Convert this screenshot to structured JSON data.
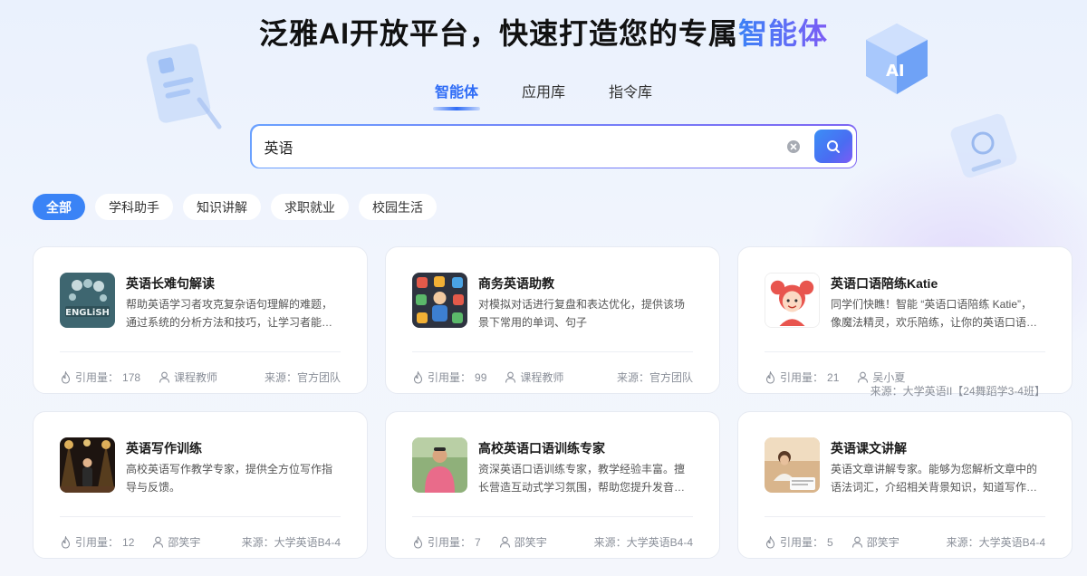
{
  "header": {
    "title_prefix": "泛雅AI开放平台，快速打造您的专属",
    "title_accent": "智能体"
  },
  "tabs": [
    {
      "label": "智能体",
      "active": true
    },
    {
      "label": "应用库",
      "active": false
    },
    {
      "label": "指令库",
      "active": false
    }
  ],
  "search": {
    "value": "英语",
    "placeholder": ""
  },
  "chips": [
    {
      "label": "全部",
      "active": true
    },
    {
      "label": "学科助手",
      "active": false
    },
    {
      "label": "知识讲解",
      "active": false
    },
    {
      "label": "求职就业",
      "active": false
    },
    {
      "label": "校园生活",
      "active": false
    }
  ],
  "cards": [
    {
      "title": "英语长难句解读",
      "desc": "帮助英语学习者攻克复杂语句理解的难题，通过系统的分析方法和技巧，让学习者能够清晰理解",
      "uses_label": "引用量：",
      "uses": "178",
      "author": "课程教师",
      "source_label": "来源：",
      "source": "官方团队",
      "thumb": "english-book-thumb"
    },
    {
      "title": "商务英语助教",
      "desc": "对模拟对话进行复盘和表达优化，提供该场景下常用的单词、句子",
      "uses_label": "引用量：",
      "uses": "99",
      "author": "课程教师",
      "source_label": "来源：",
      "source": "官方团队",
      "thumb": "business-icons-thumb"
    },
    {
      "title": "英语口语陪练Katie",
      "desc": "同学们快瞧！智能 “英语口语陪练 Katie”， 像魔法精灵，欢乐陪练，让你的英语口语起飞。",
      "uses_label": "引用量：",
      "uses": "21",
      "author": "吴小夏",
      "source_label": "来源：",
      "source": "大学英语II【24舞蹈学3-4班】",
      "thumb": "cartoon-girl-thumb"
    },
    {
      "title": "英语写作训练",
      "desc": "高校英语写作教学专家，提供全方位写作指导与反馈。",
      "uses_label": "引用量：",
      "uses": "12",
      "author": "邵笑宇",
      "source_label": "来源：",
      "source": "大学英语B4-4",
      "thumb": "stage-performer-thumb"
    },
    {
      "title": "高校英语口语训练专家",
      "desc": "资深英语口语训练专家，教学经验丰富。擅长营造互动式学习氛围，帮助您提升发音、词汇量",
      "uses_label": "引用量：",
      "uses": "7",
      "author": "邵笑宇",
      "source_label": "来源：",
      "source": "大学英语B4-4",
      "thumb": "teacher-photo-thumb"
    },
    {
      "title": "英语课文讲解",
      "desc": "英语文章讲解专家。能够为您解析文章中的语法词汇，介绍相关背景知识，知道写作，答疑解惑",
      "uses_label": "引用量：",
      "uses": "5",
      "author": "邵笑宇",
      "source_label": "来源：",
      "source": "大学英语B4-4",
      "thumb": "study-photo-thumb"
    }
  ]
}
